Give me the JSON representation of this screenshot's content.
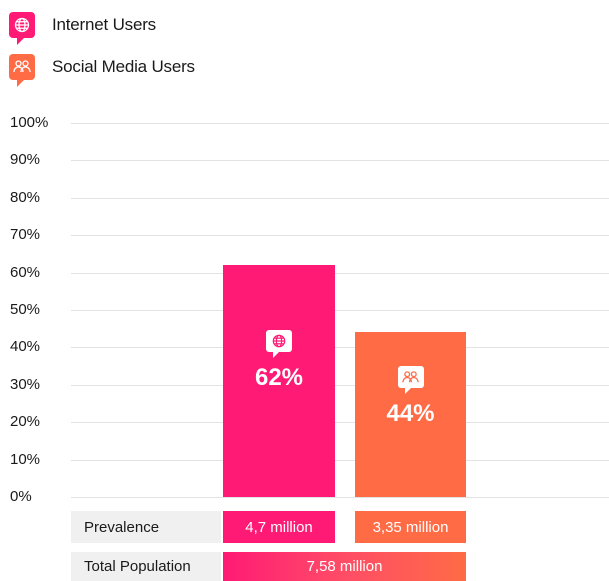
{
  "legend": [
    {
      "label": "Internet Users",
      "icon": "globe-icon",
      "color": "#ff1a75"
    },
    {
      "label": "Social Media Users",
      "icon": "people-icon",
      "color": "#ff6b45"
    }
  ],
  "chart_data": {
    "type": "bar",
    "title": "",
    "xlabel": "",
    "ylabel": "",
    "ylim": [
      0,
      100
    ],
    "y_ticks": [
      "100%",
      "90%",
      "80%",
      "70%",
      "60%",
      "50%",
      "40%",
      "30%",
      "20%",
      "10%",
      "0%"
    ],
    "categories": [
      "Internet Users",
      "Social Media Users"
    ],
    "values": [
      62,
      44
    ],
    "data_labels": [
      "62%",
      "44%"
    ],
    "colors": [
      "#ff1a75",
      "#ff6b45"
    ],
    "grid": true,
    "legend_position": "top-left"
  },
  "table": {
    "prevalence_label": "Prevalence",
    "prevalence_values": [
      "4,7 million",
      "3,35 million"
    ],
    "total_label": "Total Population",
    "total_value": "7,58 million"
  }
}
